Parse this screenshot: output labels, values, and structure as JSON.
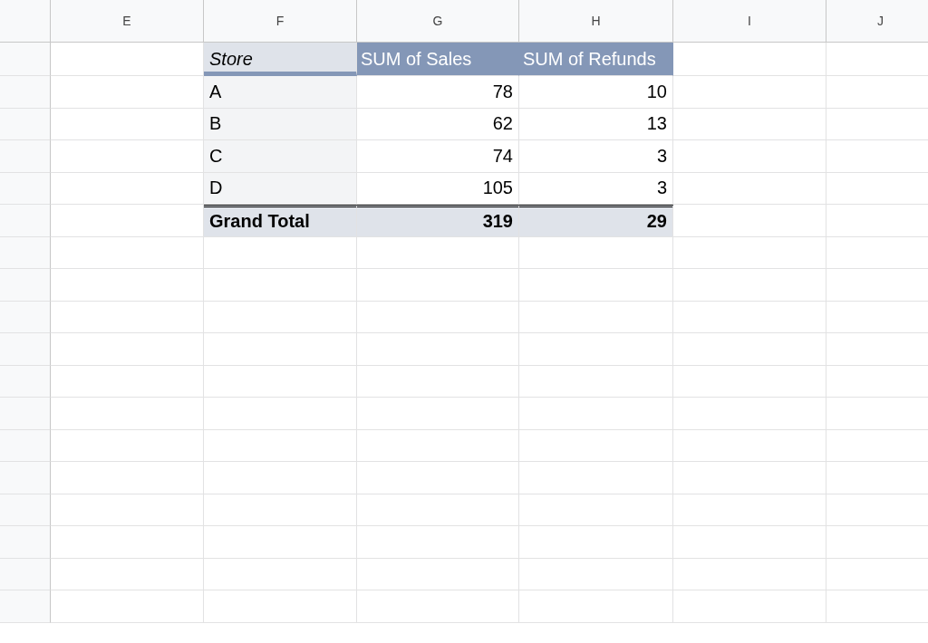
{
  "columns": [
    "E",
    "F",
    "G",
    "H",
    "I",
    "J"
  ],
  "pivot": {
    "header": {
      "row_label": "Store",
      "values": [
        "SUM of Sales",
        "SUM of Refunds"
      ]
    },
    "rows": [
      {
        "label": "A",
        "values": [
          "78",
          "10"
        ]
      },
      {
        "label": "B",
        "values": [
          "62",
          "13"
        ]
      },
      {
        "label": "C",
        "values": [
          "74",
          "3"
        ]
      },
      {
        "label": "D",
        "values": [
          "105",
          "3"
        ]
      }
    ],
    "total": {
      "label": "Grand Total",
      "values": [
        "319",
        "29"
      ]
    }
  }
}
